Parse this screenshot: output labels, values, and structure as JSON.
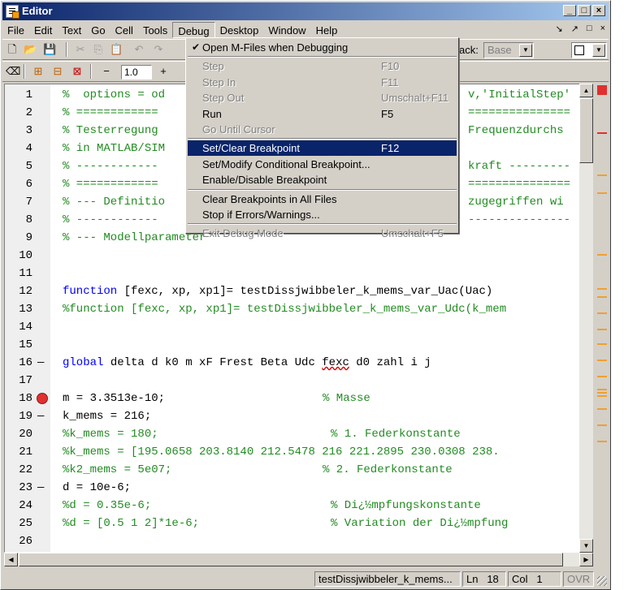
{
  "window": {
    "title": "Editor",
    "controls": {
      "minimize": "_",
      "maximize": "□",
      "close": "×"
    }
  },
  "menubar": {
    "items": [
      "File",
      "Edit",
      "Text",
      "Go",
      "Cell",
      "Tools",
      "Debug",
      "Desktop",
      "Window",
      "Help"
    ],
    "open_item": "Debug",
    "right_controls": [
      "↘",
      "↗",
      "□",
      "×"
    ]
  },
  "toolbar": {
    "stack_label": "ack:",
    "stack_value": "Base",
    "zoom_value": "1.0",
    "minus_label": "−",
    "plus_label": "+"
  },
  "debug_menu": {
    "items": [
      {
        "label": "Open M-Files when Debugging",
        "shortcut": "",
        "checked": true,
        "enabled": true,
        "selected": false
      },
      {
        "separator": true
      },
      {
        "label": "Step",
        "shortcut": "F10",
        "enabled": false
      },
      {
        "label": "Step In",
        "shortcut": "F11",
        "enabled": false
      },
      {
        "label": "Step Out",
        "shortcut": "Umschalt+F11",
        "enabled": false
      },
      {
        "label": "Run",
        "shortcut": "F5",
        "enabled": true
      },
      {
        "label": "Go Until Cursor",
        "shortcut": "",
        "enabled": false
      },
      {
        "separator": true
      },
      {
        "label": "Set/Clear Breakpoint",
        "shortcut": "F12",
        "enabled": true,
        "selected": true
      },
      {
        "label": "Set/Modify Conditional Breakpoint...",
        "shortcut": "",
        "enabled": true
      },
      {
        "label": "Enable/Disable Breakpoint",
        "shortcut": "",
        "enabled": true
      },
      {
        "separator": true
      },
      {
        "label": "Clear Breakpoints in All Files",
        "shortcut": "",
        "enabled": true
      },
      {
        "label": "Stop if Errors/Warnings...",
        "shortcut": "",
        "enabled": true
      },
      {
        "separator": true
      },
      {
        "label": "Exit Debug Mode",
        "shortcut": "Umschalt+F5",
        "enabled": false
      }
    ]
  },
  "editor": {
    "lines": [
      {
        "n": "1",
        "text": "%  options = od",
        "tail": "v,'InitialStep'",
        "type": "com"
      },
      {
        "n": "2",
        "text": "% ============",
        "tail": "===============",
        "type": "com"
      },
      {
        "n": "3",
        "text": "% Testerregung",
        "tail": "Frequenzdurchs",
        "type": "com"
      },
      {
        "n": "4",
        "text": "% in MATLAB/SIM",
        "tail": "",
        "type": "com"
      },
      {
        "n": "5",
        "text": "% ------------",
        "tail": "kraft ---------",
        "type": "com"
      },
      {
        "n": "6",
        "text": "% ============",
        "tail": "===============",
        "type": "com"
      },
      {
        "n": "7",
        "text": "% --- Definitio",
        "tail": "zugegriffen wi",
        "type": "com"
      },
      {
        "n": "8",
        "text": "% ------------",
        "tail": "---------------",
        "type": "com"
      },
      {
        "n": "9",
        "text": "% --- Modellparameter",
        "tail": "",
        "type": "com"
      },
      {
        "n": "10",
        "text": "",
        "tail": "",
        "type": "n"
      },
      {
        "n": "11",
        "text": "",
        "tail": "",
        "type": "n"
      },
      {
        "n": "12",
        "kw": "function",
        "text": " [fexc, xp, xp1]= testDissjwibbeler_k_mems_var_Uac(Uac)",
        "tail": "",
        "type": "fn"
      },
      {
        "n": "13",
        "text": "%function [fexc, xp, xp1]= testDissjwibbeler_k_mems_var_Udc(k_mem",
        "tail": "",
        "type": "com"
      },
      {
        "n": "14",
        "text": "",
        "tail": "",
        "type": "n"
      },
      {
        "n": "15",
        "text": "",
        "tail": "",
        "type": "n"
      },
      {
        "n": "16",
        "dash": true,
        "kw": "global",
        "text": " delta d k0 m xF Frest Beta Udc ",
        "wavy": "fexc",
        "after": " d0 zahl i j",
        "tail": "",
        "type": "glob"
      },
      {
        "n": "17",
        "text": "",
        "tail": "",
        "type": "n"
      },
      {
        "n": "18",
        "bp": true,
        "text": "m = 3.3513e-10;",
        "comment": "% Masse",
        "ccol": 320,
        "type": "mix"
      },
      {
        "n": "19",
        "dash": true,
        "text": "k_mems = 216;",
        "comment": "",
        "type": "mix"
      },
      {
        "n": "20",
        "text": "%k_mems = 180;",
        "comment": "% 1. Federkonstante",
        "ccol": 330,
        "type": "com2"
      },
      {
        "n": "21",
        "text": "%k_mems = [195.0658 203.8140 212.5478 216 221.2895 230.0308 238.",
        "tail": "",
        "type": "com"
      },
      {
        "n": "22",
        "text": "%k2_mems = 5e07;",
        "comment": "% 2. Federkonstante",
        "ccol": 320,
        "type": "com2"
      },
      {
        "n": "23",
        "dash": true,
        "text": "d = 10e-6;",
        "comment": "",
        "type": "mix"
      },
      {
        "n": "24",
        "text": "%d = 0.35e-6;",
        "comment": "% Di¿½mpfungskonstante",
        "ccol": 330,
        "type": "com2"
      },
      {
        "n": "25",
        "text": "%d = [0.5 1 2]*1e-6;",
        "comment": "% Variation der Di¿½mpfung",
        "ccol": 330,
        "type": "com2"
      },
      {
        "n": "26",
        "text": "",
        "tail": "",
        "type": "n"
      }
    ]
  },
  "statusbar": {
    "file": "testDissjwibbeler_k_mems...",
    "ln_label": "Ln",
    "ln_value": "18",
    "col_label": "Col",
    "col_value": "1",
    "ovr": "OVR"
  },
  "colors": {
    "comment": "#228b22",
    "keyword": "#0000ff",
    "selection": "#0a246a",
    "breakpoint": "#e03030",
    "marker": "#f0a030"
  }
}
